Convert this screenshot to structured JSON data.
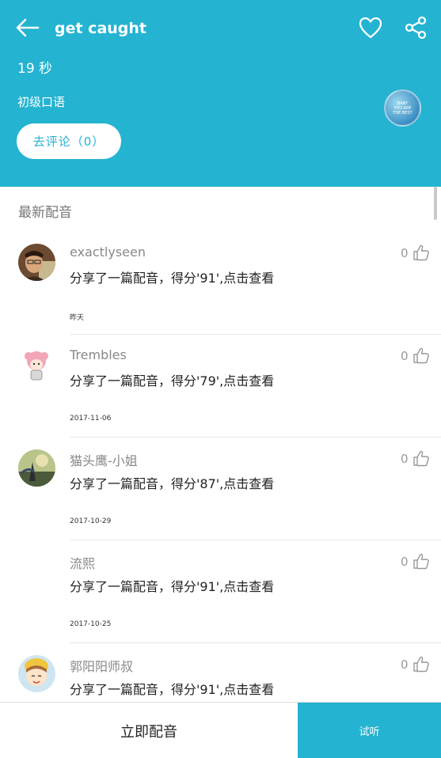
{
  "header": {
    "title": "get caught",
    "duration": "19 秒",
    "level": "初级口语",
    "comment_button": "去评论（0）",
    "cover_text": [
      "BABY",
      "YOU ARE",
      "THE BEST"
    ]
  },
  "section": {
    "title": "最新配音"
  },
  "feed": [
    {
      "user": "exactlyseen",
      "message": "分享了一篇配音，得分'91',点击查看",
      "date": "昨天",
      "likes": "0"
    },
    {
      "user": "Trembles",
      "message": "分享了一篇配音，得分'79',点击查看",
      "date": "2017-11-06",
      "likes": "0"
    },
    {
      "user": "猫头鹰-小姐",
      "message": "分享了一篇配音，得分'87',点击查看",
      "date": "2017-10-29",
      "likes": "0"
    },
    {
      "user": "流熙",
      "message": "分享了一篇配音，得分'91',点击查看",
      "date": "2017-10-25",
      "likes": "0"
    },
    {
      "user": "郭阳阳师叔",
      "message": "分享了一篇配音，得分'91',点击查看",
      "date": "",
      "likes": "0"
    }
  ],
  "footer": {
    "dub_button": "立即配音",
    "listen_button": "试听"
  },
  "colors": {
    "accent": "#24b3d1"
  }
}
